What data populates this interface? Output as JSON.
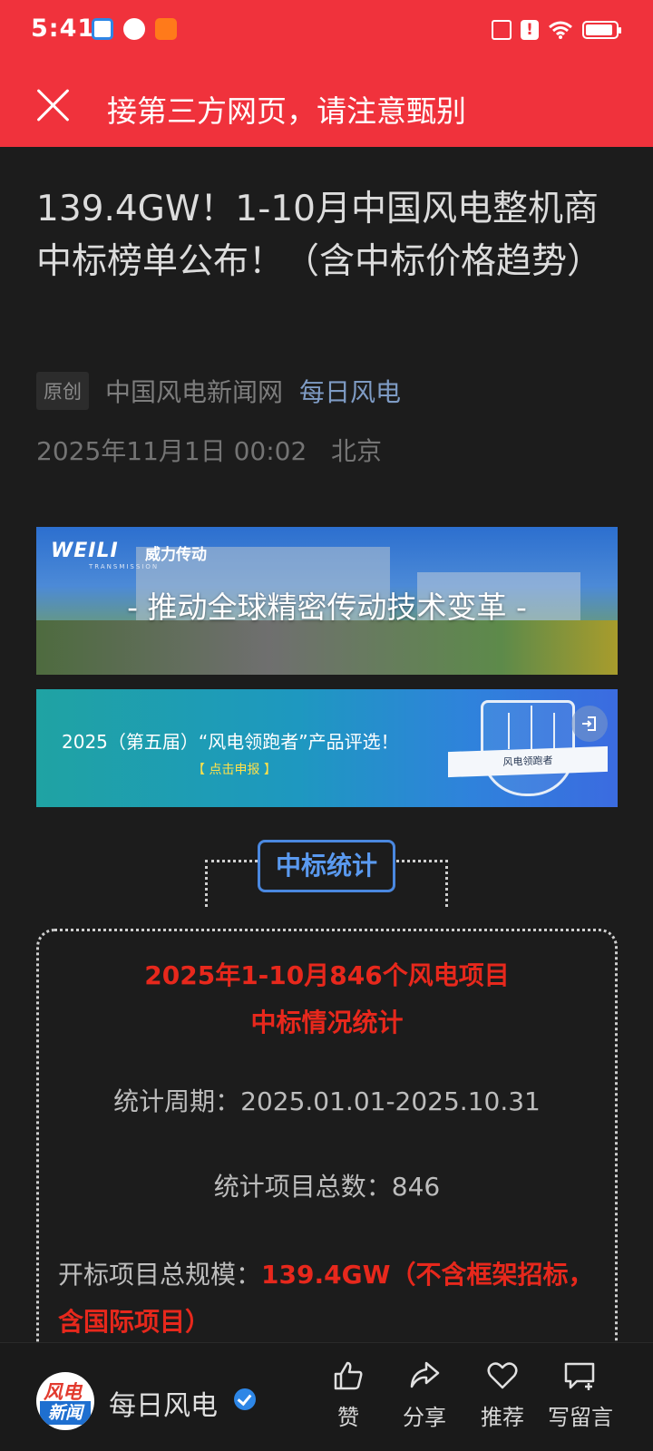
{
  "status_bar": {
    "time": "5:41"
  },
  "header": {
    "title": "接第三方网页，请注意甄别"
  },
  "article": {
    "title": "139.4GW！1-10月中国风电整机商中标榜单公布！（含中标价格趋势）",
    "tag": "原创",
    "source": "中国风电新闻网",
    "author": "每日风电",
    "date": "2025年11月1日 00:02",
    "location": "北京"
  },
  "banner1": {
    "logo": "WEILI",
    "logo_cn": "威力传动",
    "logo_sub": "TRANSMISSION",
    "slogan": "- 推动全球精密传动技术变革 -"
  },
  "banner2": {
    "text": "2025（第五届）“风电领跑者”产品评选！",
    "cta": "【 点击申报 】",
    "badge": "风电领跑者"
  },
  "stats": {
    "section_title": "中标统计",
    "heading_line1": "2025年1-10月846个风电项目",
    "heading_line2": "中标情况统计",
    "period": "统计周期：2025.01.01-2025.10.31",
    "count": "统计项目总数：846",
    "scale_label": "开标项目总规模：",
    "scale_value": "139.4GW（不含框架招标，含国际项目）"
  },
  "bottom_bar": {
    "account_name": "每日风电",
    "avatar_line1": "风电",
    "avatar_line2": "新闻",
    "like": "赞",
    "share": "分享",
    "recommend": "推荐",
    "comment": "写留言"
  }
}
